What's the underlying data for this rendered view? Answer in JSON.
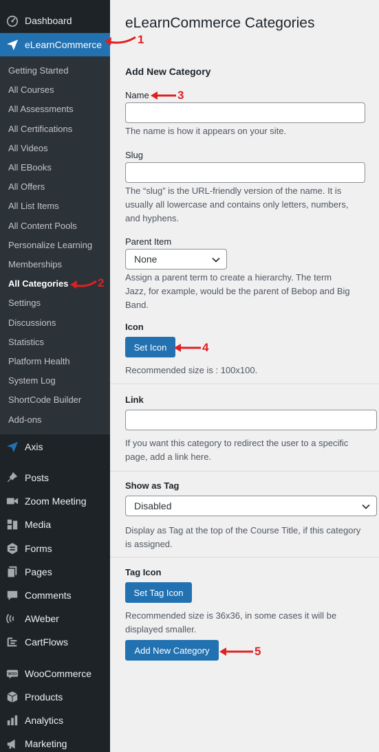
{
  "sidebar": {
    "dashboard": "Dashboard",
    "elearn": "eLearnCommerce",
    "submenu": [
      "Getting Started",
      "All Courses",
      "All Assessments",
      "All Certifications",
      "All Videos",
      "All EBooks",
      "All Offers",
      "All List Items",
      "All Content Pools",
      "Personalize Learning",
      "Memberships",
      "All Categories",
      "Settings",
      "Discussions",
      "Statistics",
      "Platform Health",
      "System Log",
      "ShortCode Builder",
      "Add-ons"
    ],
    "current_submenu": "All Categories",
    "bottom": [
      "Axis",
      "Posts",
      "Zoom Meeting",
      "Media",
      "Forms",
      "Pages",
      "Comments",
      "AWeber",
      "CartFlows",
      "WooCommerce",
      "Products",
      "Analytics",
      "Marketing"
    ],
    "icons": [
      "dashboard-icon",
      "paper-plane-icon",
      "paper-plane-icon",
      "pin-icon",
      "video-camera-icon",
      "media-icon",
      "forms-icon",
      "pages-icon",
      "comment-icon",
      "aweber-icon",
      "cartflows-icon",
      "woo-icon",
      "box-icon",
      "bar-chart-icon",
      "megaphone-icon"
    ]
  },
  "main": {
    "title": "eLearnCommerce Categories",
    "section": "Add New Category",
    "name_label": "Name",
    "name_value": "",
    "name_desc": "The name is how it appears on your site.",
    "slug_label": "Slug",
    "slug_value": "",
    "slug_desc": [
      "The “slug” is the URL-friendly version of the name. It is",
      "usually all lowercase and contains only letters, numbers,",
      "and hyphens."
    ],
    "parent_label": "Parent Item",
    "parent_value": "None",
    "parent_desc": [
      "Assign a parent term to create a hierarchy. The term",
      "Jazz, for example, would be the parent of Bebop and Big",
      "Band."
    ],
    "icon_label": "Icon",
    "set_icon": "Set Icon",
    "icon_desc": "Recommended size is : 100x100.",
    "link_label": "Link",
    "link_value": "",
    "link_desc": [
      "If you want this category to redirect the user to a specific",
      "page, add a link here."
    ],
    "tag_label": "Show as Tag",
    "tag_value": "Disabled",
    "tag_desc": [
      "Display as Tag at the top of the Course Title, if this category",
      "is assigned."
    ],
    "tag_icon_label": "Tag Icon",
    "set_tag_icon": "Set Tag Icon",
    "tag_icon_desc": [
      "Recommended size is 36x36, in some cases it will be",
      "displayed smaller."
    ],
    "submit": "Add New Category"
  },
  "annotations": [
    "1",
    "2",
    "3",
    "4",
    "5"
  ],
  "colors": {
    "accent": "#2271b1",
    "annotation": "#e02020",
    "sidebar": "#1d2327"
  }
}
